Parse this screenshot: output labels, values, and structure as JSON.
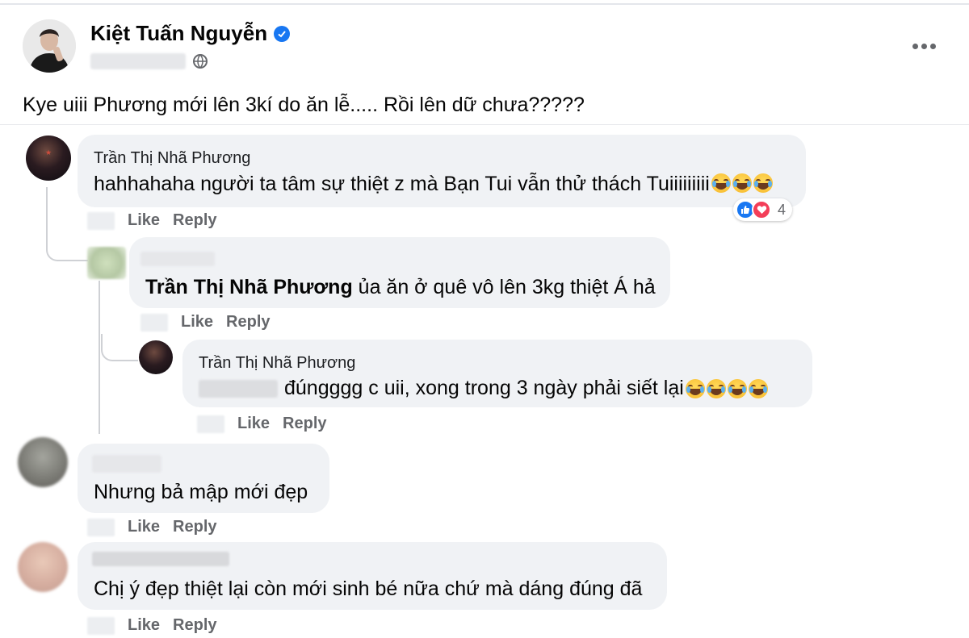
{
  "post": {
    "author": "Kiệt Tuấn Nguyễn",
    "text": "Kye uiii Phương mới lên 3kí do ăn lễ..... Rồi lên dữ chưa?????"
  },
  "labels": {
    "like": "Like",
    "reply": "Reply"
  },
  "comments": [
    {
      "name": "Trần Thị Nhã Phương",
      "text": "hahhahaha người ta tâm sự thiệt z mà Bạn Tui vẫn thử thách Tuiiiiiiiii",
      "reaction_count": "4",
      "reactions": [
        "like-icon",
        "love-icon"
      ]
    },
    {
      "mention": "Trần Thị Nhã Phương",
      "text": "ủa ăn ở quê vô lên 3kg thiệt Á hả"
    },
    {
      "name": "Trần Thị Nhã Phương",
      "text": "đúngggg c uii, xong trong 3 ngày phải siết lại"
    },
    {
      "text": "Nhưng bả mập mới đẹp"
    },
    {
      "text": "Chị ý đẹp thiệt lại còn mới sinh bé nữa chứ mà dáng đúng đã"
    }
  ],
  "colors": {
    "bubble": "#f0f2f5",
    "action_text": "#65676b",
    "verified": "#1877f2",
    "love": "#f33e58"
  }
}
